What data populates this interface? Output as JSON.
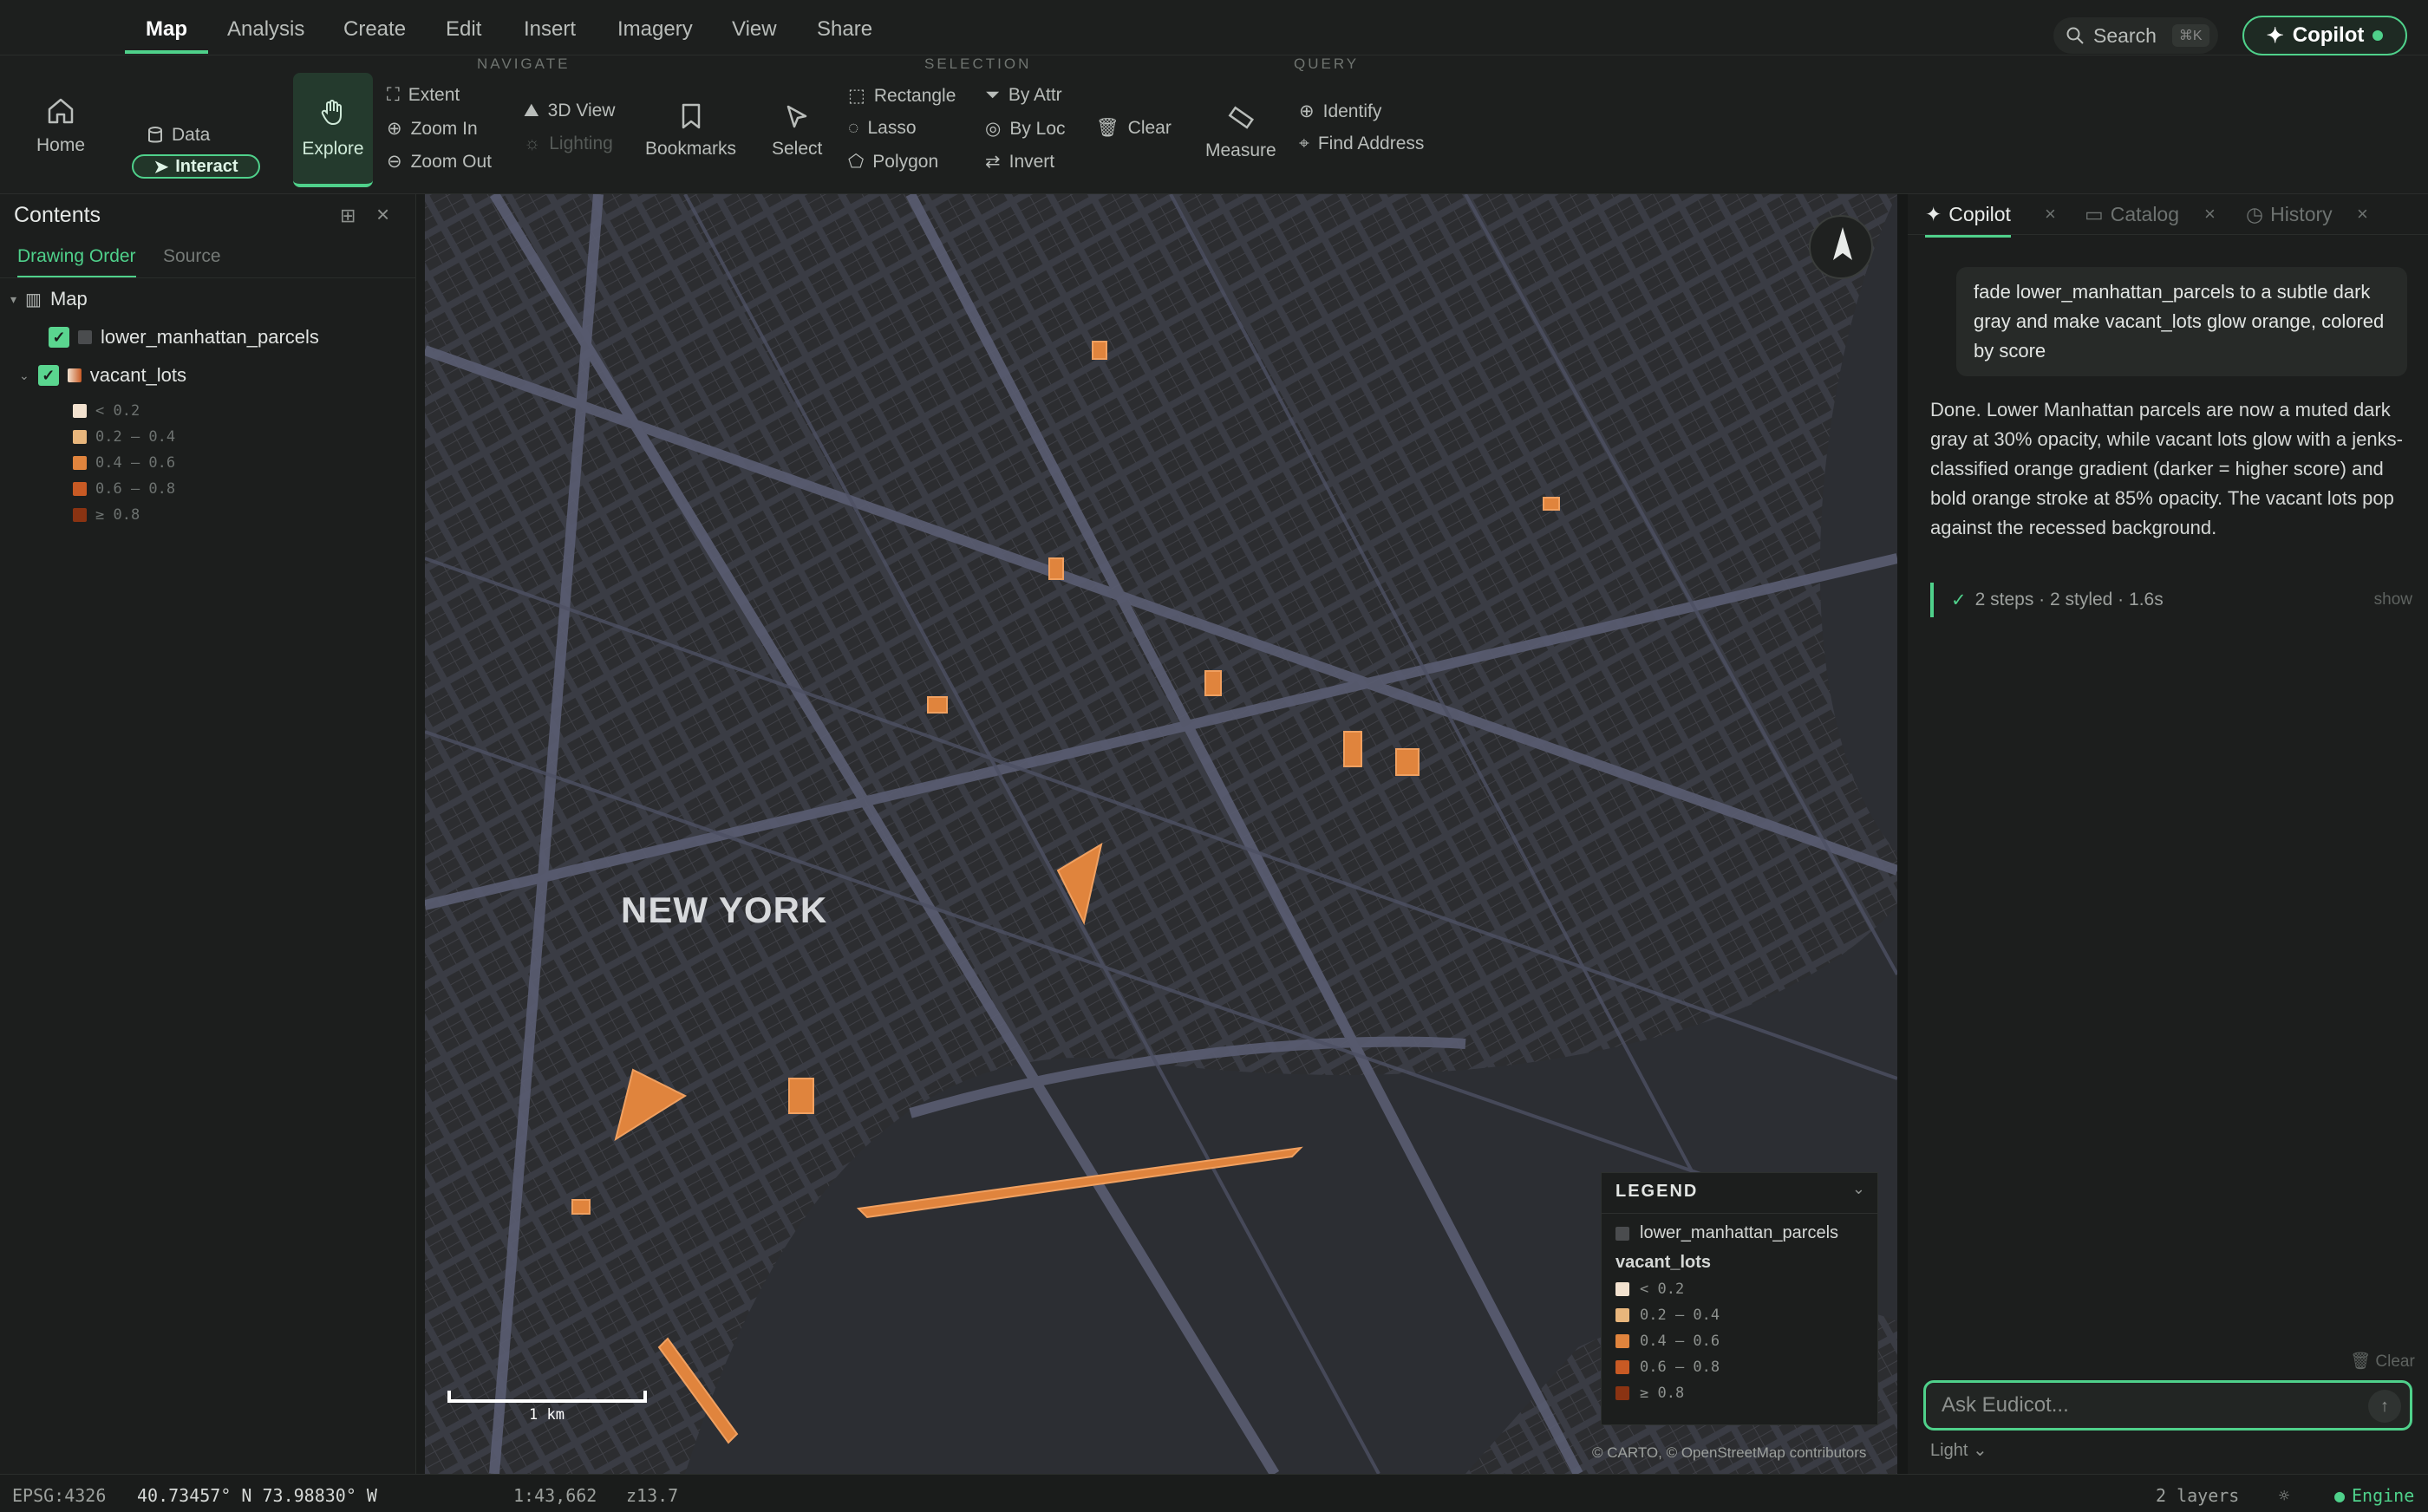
{
  "menu": {
    "items": [
      "Map",
      "Analysis",
      "Create",
      "Edit",
      "Insert",
      "Imagery",
      "View",
      "Share"
    ]
  },
  "search": {
    "label": "Search",
    "shortcut": "⌘K"
  },
  "copilot_button": {
    "label": "Copilot"
  },
  "ribbon": {
    "home": "Home",
    "interact": "Interact",
    "data": "Data",
    "explore": "Explore",
    "navigate_label": "NAVIGATE",
    "extent": "Extent",
    "zoom_in": "Zoom In",
    "zoom_out": "Zoom Out",
    "view3d": "3D View",
    "lighting": "Lighting",
    "bookmarks": "Bookmarks",
    "select": "Select",
    "selection_label": "SELECTION",
    "rectangle": "Rectangle",
    "lasso": "Lasso",
    "polygon": "Polygon",
    "by_attr": "By Attr",
    "by_loc": "By Loc",
    "invert": "Invert",
    "clear": "Clear",
    "measure": "Measure",
    "query_label": "QUERY",
    "identify": "Identify",
    "find_address": "Find Address"
  },
  "contents": {
    "title": "Contents",
    "tabs": [
      "Drawing Order",
      "Source"
    ],
    "root": "Map",
    "layers": [
      "lower_manhattan_parcels",
      "vacant_lots"
    ],
    "classes": [
      "< 0.2",
      "0.2 – 0.4",
      "0.4 – 0.6",
      "0.6 – 0.8",
      "≥ 0.8"
    ],
    "class_colors": [
      "#f2e2cf",
      "#e8b67c",
      "#e0843d",
      "#c85a24",
      "#8a3312"
    ]
  },
  "map": {
    "place_label": "NEW YORK",
    "scale_label": "1 km",
    "attribution": "© CARTO, © OpenStreetMap contributors"
  },
  "legend": {
    "title": "LEGEND",
    "layer1": "lower_manhattan_parcels",
    "layer2": "vacant_lots"
  },
  "right": {
    "tabs": [
      "Copilot",
      "Catalog",
      "History"
    ],
    "user_message": "fade lower_manhattan_parcels to a subtle dark gray and make vacant_lots glow orange, colored by score",
    "assistant_message": "Done. Lower Manhattan parcels are now a muted dark gray at 30% opacity, while vacant lots glow with a jenks-classified orange gradient (darker = higher score) and bold orange stroke at 85% opacity. The vacant lots pop against the recessed background.",
    "steps": "2 steps · 2 styled · 1.6s",
    "show": "show",
    "clear": "Clear",
    "placeholder": "Ask Eudicot...",
    "theme": "Light"
  },
  "status": {
    "crs": "EPSG:4326",
    "coords": "40.73457° N 73.98830° W",
    "scale": "1:43,662",
    "zoom": "z13.7",
    "layers": "2 layers",
    "engine": "Engine"
  }
}
